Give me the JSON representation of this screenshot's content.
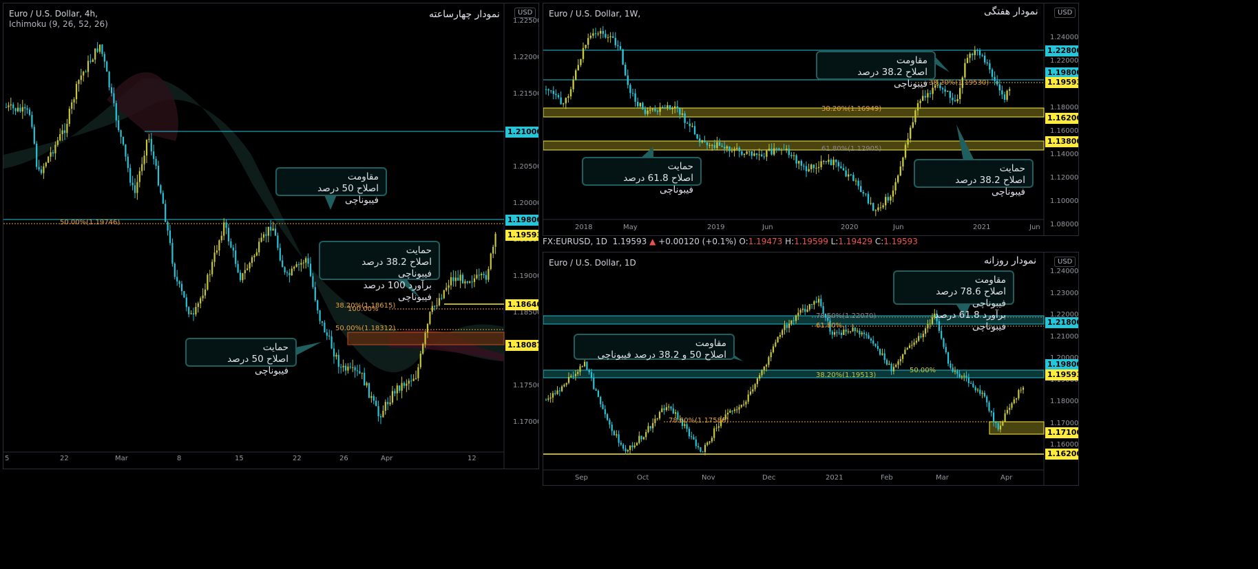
{
  "colors": {
    "up": "#c8c83a",
    "down": "#26c6da",
    "cyan_line": "#26c6da",
    "yellow_line": "#ffeb3b",
    "fib": "#e8a33d",
    "zone": "#c9b83a"
  },
  "left": {
    "symbol": "Euro / U.S. Dollar, 4h,",
    "indicator": "Ichimoku (9, 26, 52, 26)",
    "title": "نمودار چهارساعته",
    "currency": "USD",
    "ticks": [
      "1.22500",
      "1.22000",
      "1.21500",
      "1.21000",
      "1.20500",
      "1.20000",
      "1.19500",
      "1.19000",
      "1.18500",
      "1.18000",
      "1.17500",
      "1.17000"
    ],
    "xticks": [
      "5",
      "22",
      "Mar",
      "8",
      "15",
      "22",
      "26",
      "Apr",
      "12"
    ],
    "labels": {
      "l1": "1.21000",
      "l2": "1.19800",
      "l3": "1.19593",
      "l4": "1.18640",
      "l5": "1.18087"
    },
    "fib": {
      "f1": "50.00%(1.19746)",
      "f2": "38.20%(1.18615)",
      "f3": "100.00%",
      "f4": "50.00%(1.18312)"
    },
    "notes": {
      "n1": "مقاومت\nاصلاح 50 درصد فیبوناچی",
      "n2": "حمایت\nاصلاح 38.2 درصد فیبوناچی\nبرآورد 100 درصد فیبوناچی",
      "n3": "حمایت\nاصلاح 50 درصد فیبوناچی"
    }
  },
  "weekly": {
    "symbol": "Euro / U.S. Dollar, 1W,",
    "title": "نمودار هفتگی",
    "currency": "USD",
    "ticks": [
      "1.24000",
      "1.22000",
      "1.20000",
      "1.18000",
      "1.16000",
      "1.14000",
      "1.12000",
      "1.10000",
      "1.08000"
    ],
    "xticks": [
      "2018",
      "May",
      "2019",
      "Jun",
      "2020",
      "Jun",
      "2021",
      "Jun"
    ],
    "labels": {
      "l1": "1.22800",
      "l2": "1.19800",
      "l3": "1.19593",
      "l4": "1.16200",
      "l5": "1.13800"
    },
    "fib": {
      "f1": "38.20%(1.19530)",
      "f2": "38.20%(1.16949)",
      "f3": "61.80%(1.12905)"
    },
    "notes": {
      "n1": "مقاومت\nاصلاح 38.2 درصد فیبوناچی",
      "n2": "حمایت\nاصلاح 61.8 درصد فیبوناچی",
      "n3": "حمایت\nاصلاح 38.2 درصد فیبوناچی"
    }
  },
  "header": {
    "symbol": "FX:EURUSD, 1D",
    "price": "1.19593",
    "arrow": "▲",
    "change": "+0.00120 (+0.1%)",
    "o_label": "O:",
    "o": "1.19473",
    "h_label": "H:",
    "h": "1.19599",
    "l_label": "L:",
    "l": "1.19429",
    "c_label": "C:",
    "c": "1.19593"
  },
  "daily": {
    "symbol": "Euro / U.S. Dollar, 1D",
    "title": "نمودار روزانه",
    "currency": "USD",
    "ticks": [
      "1.24000",
      "1.23000",
      "1.22000",
      "1.21000",
      "1.20000",
      "1.19000",
      "1.18000",
      "1.17000",
      "1.16000"
    ],
    "xticks": [
      "Sep",
      "Oct",
      "Nov",
      "Dec",
      "2021",
      "Feb",
      "Mar",
      "Apr"
    ],
    "labels": {
      "l1": "1.21800",
      "l2": "1.19800",
      "l3": "1.19593",
      "l4": "1.17100",
      "l5": "1.16200"
    },
    "fib": {
      "f1": "78.60%(1.22070)",
      "f2": "61.80%",
      "f3": "50.00%",
      "f4": "38.20%(1.19513)",
      "f5": "78.60%(1.17586)"
    },
    "notes": {
      "n1": "مقاومت\nاصلاح 78.6 درصد فیبوناچی\nبرآورد 61.8 درصد فیبوناچی",
      "n2": "مقاومت\nاصلاح 50 و 38.2 درصد فیبوناچی"
    }
  }
}
